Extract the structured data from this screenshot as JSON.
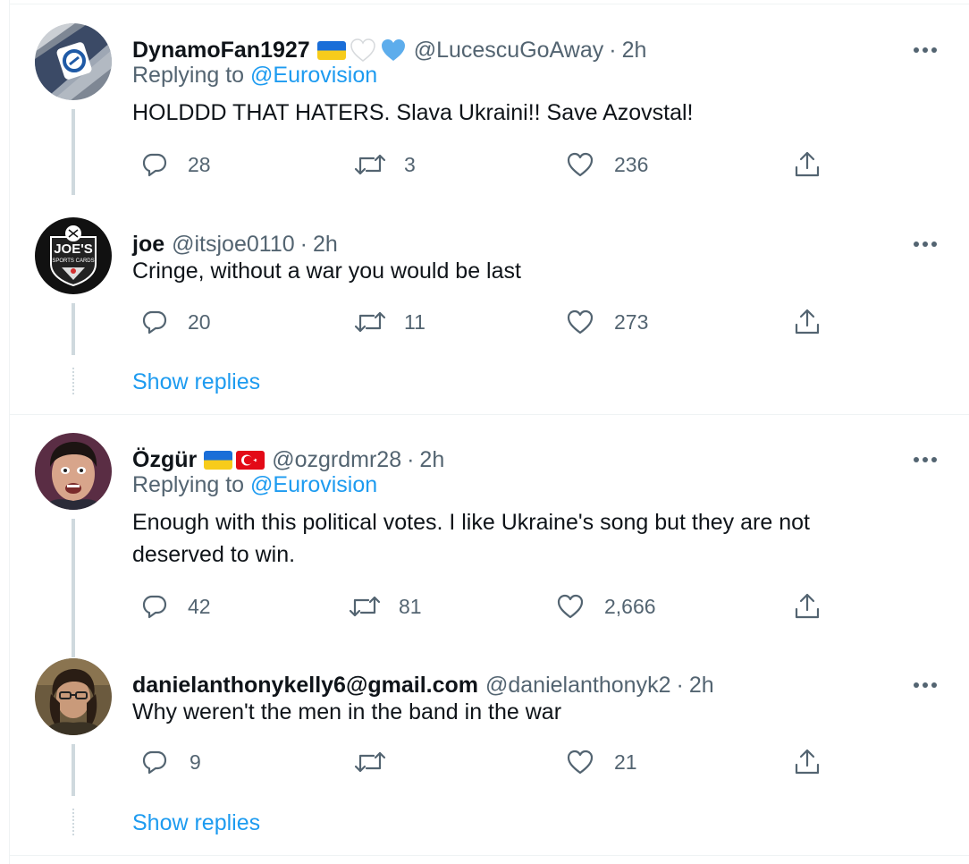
{
  "tweets": [
    {
      "name": "DynamoFan1927",
      "handle": "@LucescuGoAway",
      "sep": "·",
      "time": "2h",
      "replying_prefix": "Replying to ",
      "replying_to": "@Eurovision",
      "text": "HOLDDD THAT HATERS. Slava Ukraini!! Save Azovstal!",
      "replies": "28",
      "retweets": "3",
      "likes": "236",
      "flags": [
        "ukraine-flag",
        "white-heart",
        "blue-heart"
      ]
    },
    {
      "name": "joe",
      "handle": "@itsjoe0110",
      "sep": "·",
      "time": "2h",
      "text": "Cringe, without a war you would be last",
      "replies": "20",
      "retweets": "11",
      "likes": "273"
    },
    {
      "name": "Özgür",
      "handle": "@ozgrdmr28",
      "sep": "·",
      "time": "2h",
      "replying_prefix": "Replying to ",
      "replying_to": "@Eurovision",
      "text_line1": "Enough with this political votes. I like Ukraine's song but they are not",
      "text_line2": "deserved to win.",
      "replies": "42",
      "retweets": "81",
      "likes": "2,666",
      "flags": [
        "ukraine-flag",
        "turkey-flag"
      ]
    },
    {
      "name": "danielanthonykelly6@gmail.com",
      "handle": "@danielanthonyk2",
      "sep": "·",
      "time": "2h",
      "text": "Why weren't the men in the band in the war",
      "replies": "9",
      "retweets": "",
      "likes": "21"
    }
  ],
  "show_replies_label": "Show replies",
  "avatar_texts": {
    "joe_logo_line1": "JOE'S",
    "joe_logo_line2": "SPORTS CARDS"
  },
  "colors": {
    "accent": "#1d9bf0",
    "secondary_text": "#536471",
    "primary_text": "#0f1419",
    "border": "#eff3f4",
    "thread_line": "#cfd9de"
  },
  "icons": [
    "reply-icon",
    "retweet-icon",
    "like-icon",
    "share-icon",
    "more-icon"
  ]
}
